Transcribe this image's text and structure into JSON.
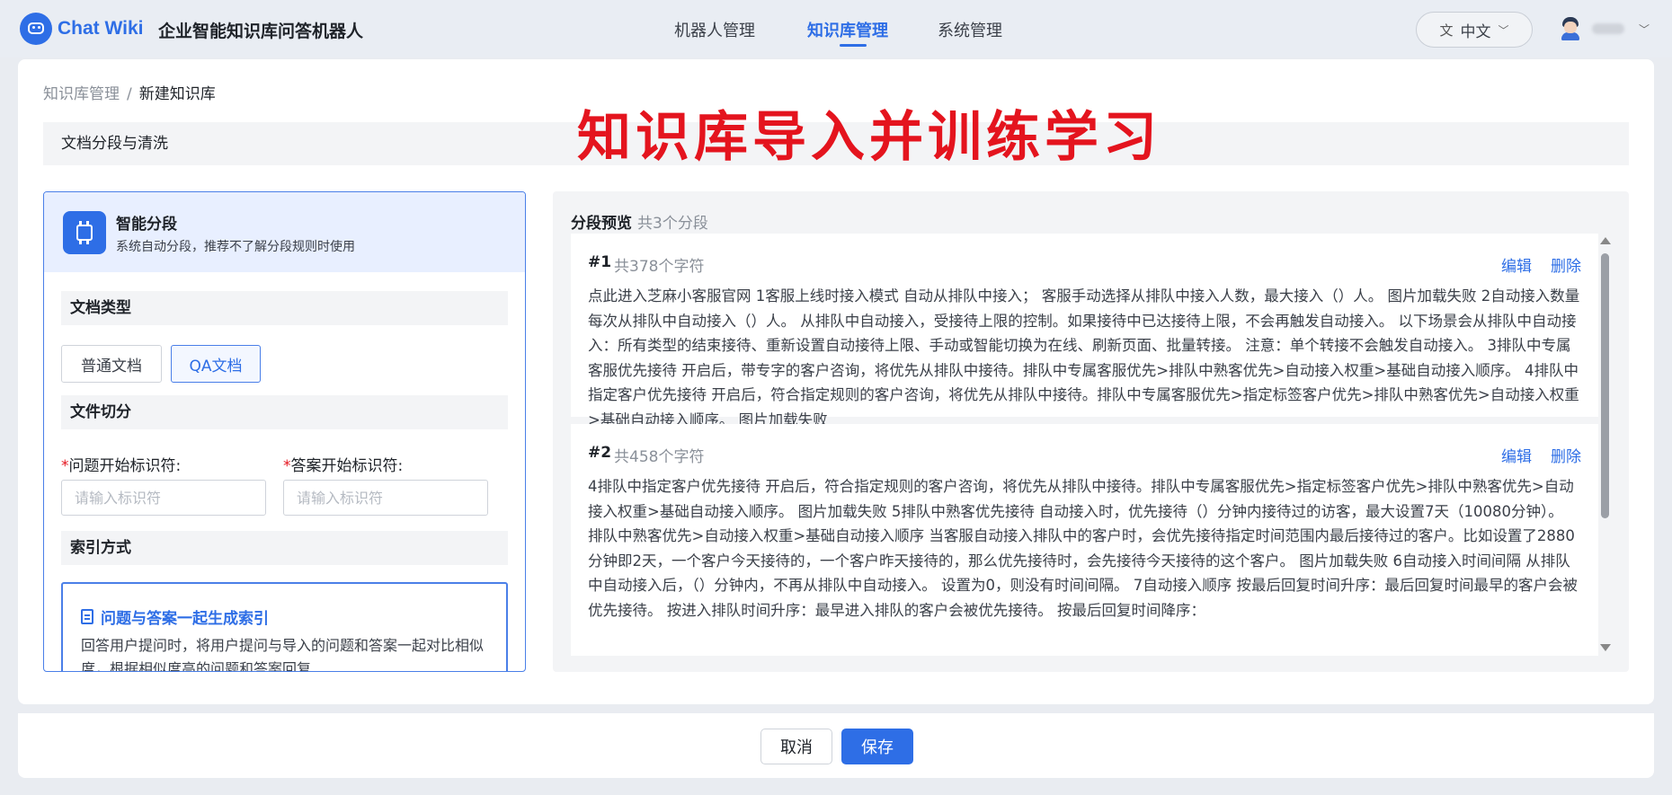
{
  "header": {
    "logo_text": "Chat Wiki",
    "app_title": "企业智能知识库问答机器人",
    "nav": [
      "机器人管理",
      "知识库管理",
      "系统管理"
    ],
    "active_nav": "知识库管理",
    "language": "中文",
    "lang_icon": "translate-icon"
  },
  "breadcrumb": {
    "parent": "知识库管理",
    "sep": "/",
    "current": "新建知识库"
  },
  "overlay_title": "知识库导入并训练学习",
  "section_title": "文档分段与清洗",
  "left": {
    "mode_title": "智能分段",
    "mode_desc": "系统自动分段，推荐不了解分段规则时使用",
    "doc_type_title": "文档类型",
    "doc_types": [
      "普通文档",
      "QA文档"
    ],
    "selected_doc_type": "QA文档",
    "split_title": "文件切分",
    "question_label": "问题开始标识符:",
    "answer_label": "答案开始标识符:",
    "required_mark": "*",
    "question_placeholder": "请输入标识符",
    "answer_placeholder": "请输入标识符",
    "index_title": "索引方式",
    "index_option_title": "问题与答案一起生成索引",
    "index_option_desc": "回答用户提问时，将用户提问与导入的问题和答案一起对比相似度，根据相似度高的问题和答案回复"
  },
  "preview": {
    "title": "分段预览",
    "count": "共3个分段",
    "edit_label": "编辑",
    "delete_label": "删除",
    "segments": [
      {
        "num": "#1",
        "chars": "共378个字符",
        "text": "点此进入芝麻小客服官网 1客服上线时接入模式 自动从排队中接入； 客服手动选择从排队中接入人数，最大接入（）人。 图片加载失败 2自动接入数量 每次从排队中自动接入（）人。 从排队中自动接入，受接待上限的控制。如果接待中已达接待上限，不会再触发自动接入。 以下场景会从排队中自动接入：所有类型的结束接待、重新设置自动接待上限、手动或智能切换为在线、刷新页面、批量转接。 注意：单个转接不会触发自动接入。 3排队中专属客服优先接待 开启后，带专字的客户咨询，将优先从排队中接待。排队中专属客服优先>排队中熟客优先>自动接入权重>基础自动接入顺序。 4排队中指定客户优先接待 开启后，符合指定规则的客户咨询，将优先从排队中接待。排队中专属客服优先>指定标签客户优先>排队中熟客优先>自动接入权重>基础自动接入顺序。 图片加载失败"
      },
      {
        "num": "#2",
        "chars": "共458个字符",
        "text": "4排队中指定客户优先接待 开启后，符合指定规则的客户咨询，将优先从排队中接待。排队中专属客服优先>指定标签客户优先>排队中熟客优先>自动接入权重>基础自动接入顺序。 图片加载失败 5排队中熟客优先接待 自动接入时，优先接待（）分钟内接待过的访客，最大设置7天（10080分钟）。 排队中熟客优先>自动接入权重>基础自动接入顺序 当客服自动接入排队中的客户时，会优先接待指定时间范围内最后接待过的客户。比如设置了2880分钟即2天，一个客户今天接待的，一个客户昨天接待的，那么优先接待时，会先接待今天接待的这个客户。 图片加载失败 6自动接入时间间隔 从排队中自动接入后，（）分钟内，不再从排队中自动接入。 设置为0，则没有时间间隔。 7自动接入顺序 按最后回复时间升序：最后回复时间最早的客户会被优先接待。 按进入排队时间升序：最早进入排队的客户会被优先接待。 按最后回复时间降序："
      }
    ]
  },
  "footer": {
    "cancel_label": "取消",
    "save_label": "保存"
  },
  "colors": {
    "brand": "#2e6ee6",
    "overlay": "#e4141e",
    "required": "#e4141e"
  }
}
